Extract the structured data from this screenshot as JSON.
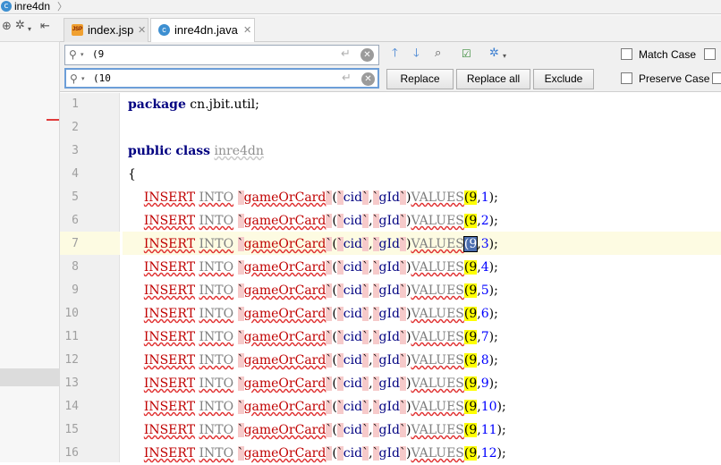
{
  "breadcrumb": {
    "icon": "c",
    "label": "inre4dn"
  },
  "tabs": [
    {
      "label": "index.jsp",
      "icon": "jsp-file-icon",
      "icon_text": "JSP"
    },
    {
      "label": "inre4dn.java",
      "icon": "java-class-icon",
      "icon_text": "c"
    }
  ],
  "find": {
    "search_value": "(9",
    "replace_value": "(10",
    "buttons": {
      "replace": "Replace",
      "replace_all": "Replace all",
      "exclude": "Exclude"
    },
    "options": {
      "match_case": "Match Case",
      "preserve_case": "Preserve Case"
    }
  },
  "editor": {
    "line_numbers": [
      "1",
      "2",
      "3",
      "4",
      "5",
      "6",
      "7",
      "8",
      "9",
      "10",
      "11",
      "12",
      "13",
      "14",
      "15",
      "16"
    ],
    "package_kw": "package",
    "package_name": " cn.jbit.util;",
    "public_kw": "public",
    "class_kw": "class",
    "class_name": "inre4dn",
    "open_brace": "{",
    "stmt": {
      "insert": "INSERT",
      "into": "INTO",
      "table": "gameOrCard",
      "col1": "cid",
      "col2": "gId",
      "values": "VALUES",
      "match": "(9"
    },
    "second_values": [
      "1",
      "2",
      "3",
      "4",
      "5",
      "6",
      "7",
      "8",
      "9",
      "10",
      "11",
      "12"
    ]
  },
  "colors": {
    "keyword": "#000080",
    "sql_keyword": "#c00000",
    "number": "#0000ff",
    "search_highlight": "#ffff00",
    "current_line": "#fdfbe2"
  }
}
